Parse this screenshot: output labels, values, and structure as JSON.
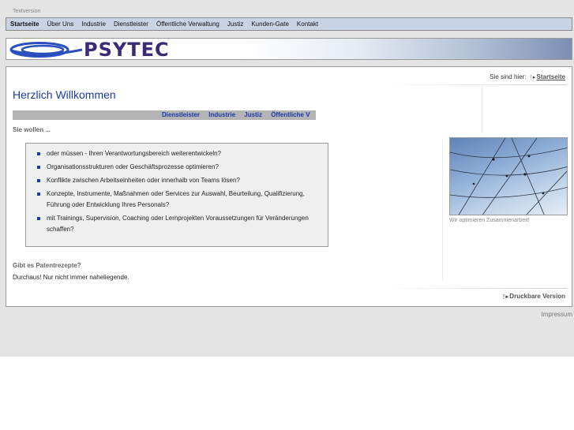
{
  "textversion_label": "Textversion",
  "topnav": {
    "items": [
      {
        "label": "Startseite"
      },
      {
        "label": "Über Uns"
      },
      {
        "label": "Industrie"
      },
      {
        "label": "Dienstleister"
      },
      {
        "label": "Öffentliche Verwaltung"
      },
      {
        "label": "Justiz"
      },
      {
        "label": "Kunden-Gate"
      },
      {
        "label": "Kontakt"
      }
    ]
  },
  "logo": {
    "wordmark": "PSYTEC",
    "swoosh_color": "#2a4fbf",
    "wordmark_color": "#3b2a78"
  },
  "breadcrumb": {
    "prefix": "Sie sind hier:",
    "current": "Startseite"
  },
  "main": {
    "title": "Herzlich Willkommen",
    "subnav": [
      {
        "label": "Dienstleister"
      },
      {
        "label": "Industrie"
      },
      {
        "label": "Justiz"
      },
      {
        "label": "Öffentliche V"
      }
    ],
    "intro": "Sie wollen ...",
    "bullets": [
      "oder müssen - Ihren Verantwortungsbereich weiterentwickeln?",
      "Organisationsstrukturen oder Geschäftsprozesse optimieren?",
      "Konflikte zwischen Arbeitseinheiten oder innerhalb von Teams lösen?",
      "Konzepte, Instrumente, Maßnahmen oder Services zur Auswahl, Beurteilung, Qualifizierung, Führung oder Entwicklung Ihres Personals?",
      "mit Trainings, Supervision, Coaching oder Lernprojekten Voraussetzungen für Veränderungen schaffen?"
    ],
    "patent_heading": "Gibt es Patentrezepte?",
    "patent_text": "Durchaus! Nur nicht immer naheliegende.",
    "print_label": "Druckbare Version"
  },
  "side": {
    "caption": "Wir optimieren Zusammenarbeit!"
  },
  "footer": {
    "impressum": "Impressum"
  },
  "colors": {
    "accent": "#1b3aa8",
    "nav_bg": "#c8d4e6",
    "page_bg": "#e4e4e4"
  }
}
